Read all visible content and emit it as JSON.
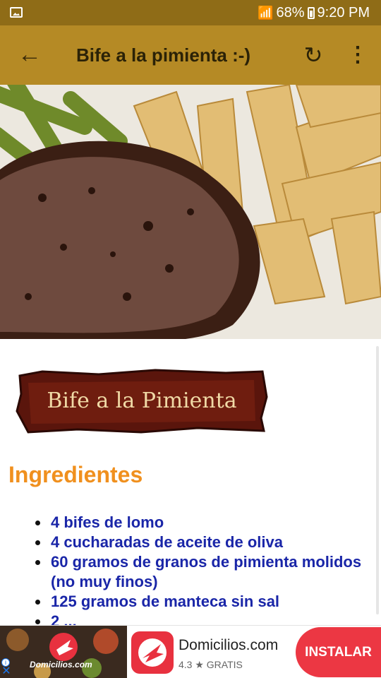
{
  "status_bar": {
    "battery": "68%",
    "time": "9:20 PM"
  },
  "toolbar": {
    "title": "Bife a la pimienta :-)"
  },
  "content": {
    "banner_text": "Bife a la Pimienta",
    "ingredients_heading": "Ingredientes",
    "ingredients": [
      "4 bifes de lomo",
      "4 cucharadas de aceite de oliva",
      "60 gramos de granos de pimienta molidos (no muy finos)",
      "125 gramos de manteca sin sal",
      "2 ... "
    ]
  },
  "ad": {
    "image_label": "Domicilios.com",
    "app_name": "Domicilios.com",
    "rating": "4.3 ★ GRATIS",
    "install_label": "INSTALAR"
  },
  "colors": {
    "status_bar": "#8f6c17",
    "toolbar": "#b58a25",
    "heading": "#f0901e",
    "ingredient_text": "#1a26a8",
    "install_button": "#ec3743"
  }
}
